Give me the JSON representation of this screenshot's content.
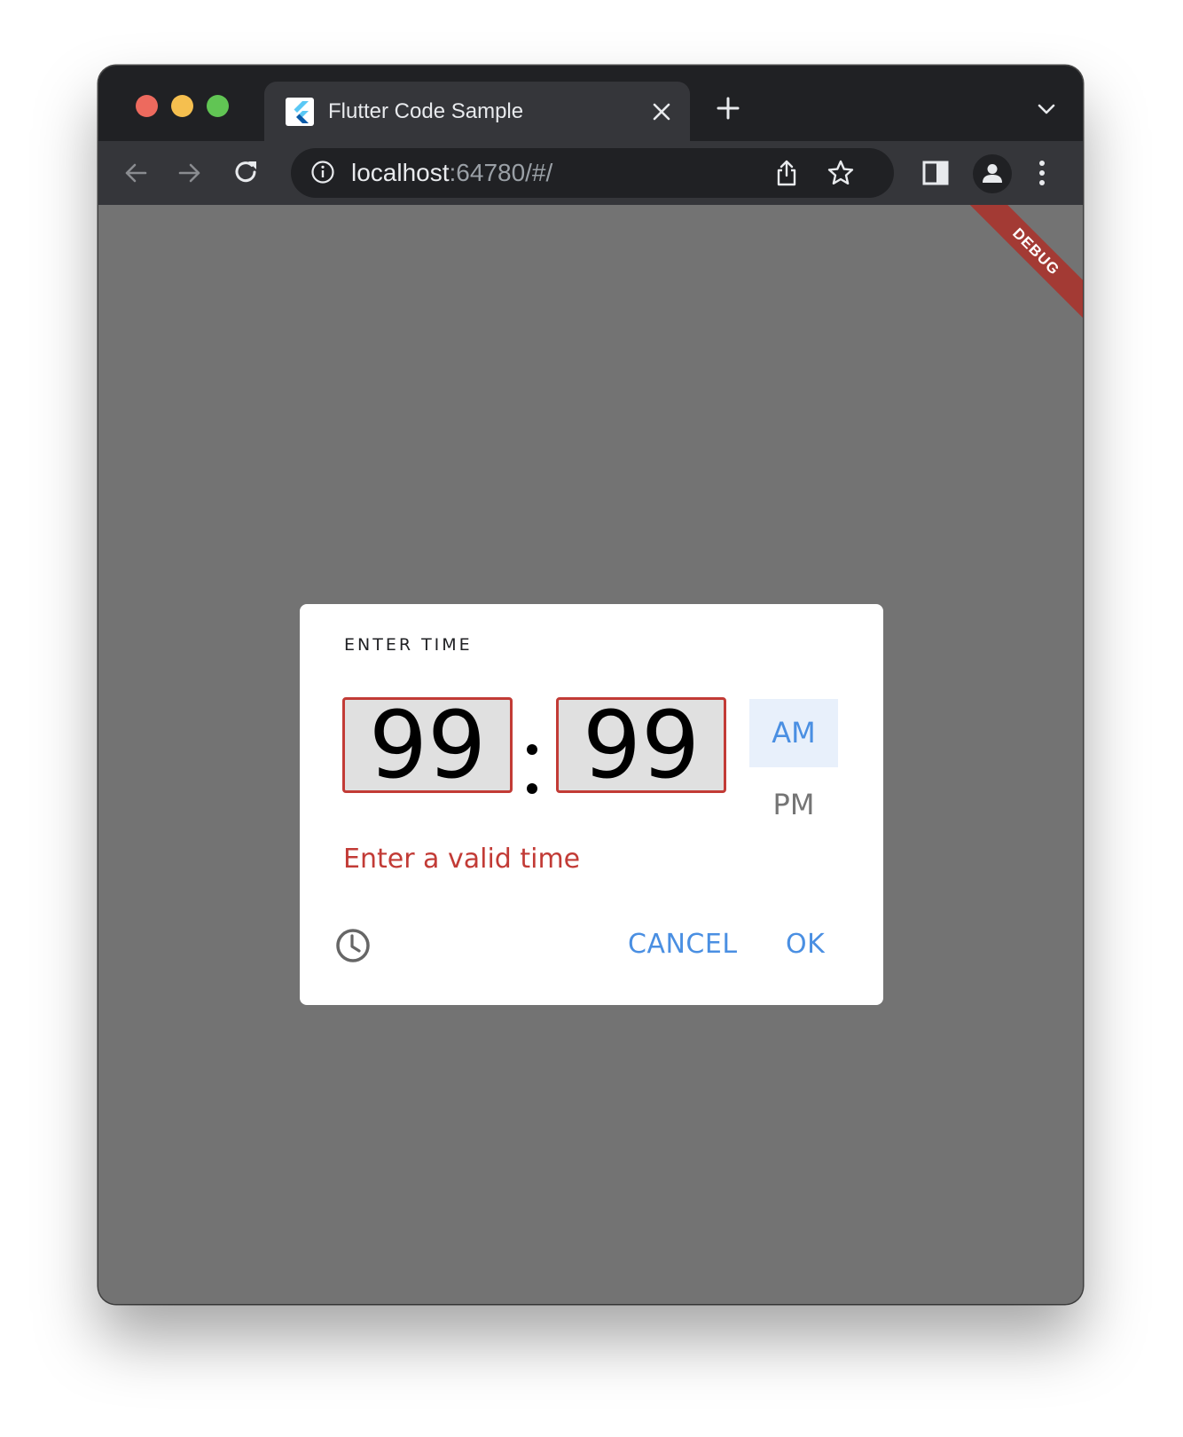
{
  "browser": {
    "tab_title": "Flutter Code Sample",
    "url_host": "localhost",
    "url_rest": ":64780/#/"
  },
  "debug_banner": "DEBUG",
  "dialog": {
    "help_text": "ENTER TIME",
    "hour_value": "99",
    "minute_value": "99",
    "am_label": "AM",
    "pm_label": "PM",
    "selected_period": "AM",
    "error_text": "Enter a valid time",
    "cancel_label": "CANCEL",
    "ok_label": "OK"
  },
  "colors": {
    "accent": "#4a8fe2",
    "error": "#c23b36",
    "scrim": "#737373",
    "debug_banner": "#a33a34"
  },
  "icons": {
    "tab_favicon": "flutter-logo-icon",
    "tab_close": "close-icon",
    "new_tab": "plus-icon",
    "tab_menu": "chevron-down-icon",
    "back": "arrow-left-icon",
    "forward": "arrow-right-icon",
    "reload": "reload-icon",
    "site_info": "info-icon",
    "share": "share-icon",
    "bookmark": "star-icon",
    "side_panel": "side-panel-icon",
    "profile": "profile-icon",
    "menu": "kebab-menu-icon",
    "mode_toggle": "clock-icon"
  }
}
